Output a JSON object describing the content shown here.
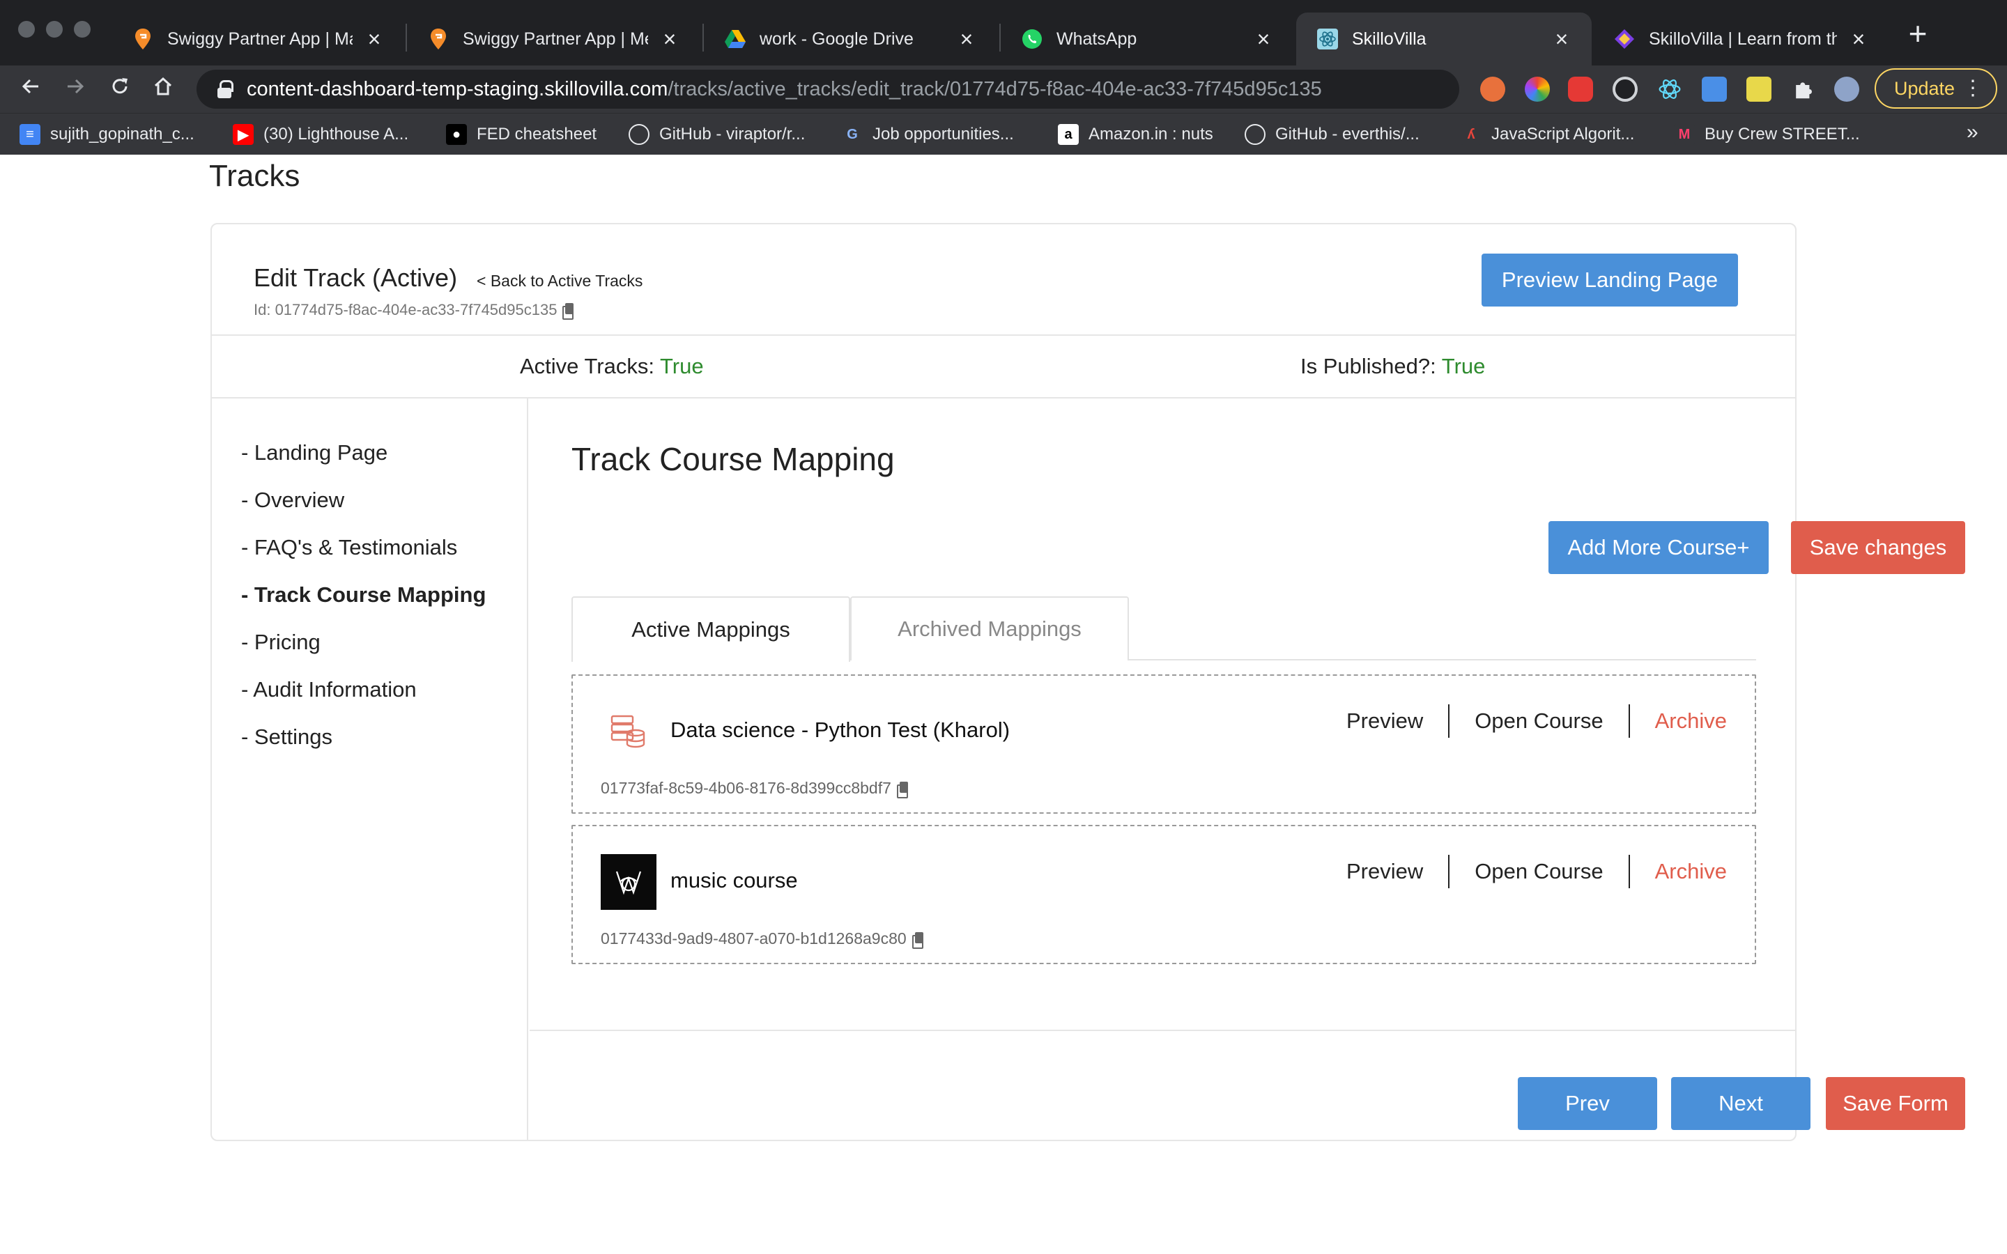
{
  "browser": {
    "tabs": [
      {
        "title": "Swiggy Partner App | Man",
        "icon": "swiggy-icon"
      },
      {
        "title": "Swiggy Partner App | Men",
        "icon": "swiggy-icon"
      },
      {
        "title": "work - Google Drive",
        "icon": "google-drive-icon"
      },
      {
        "title": "WhatsApp",
        "icon": "whatsapp-icon"
      },
      {
        "title": "SkilloVilla",
        "icon": "react-icon",
        "active": true
      },
      {
        "title": "SkilloVilla | Learn from the",
        "icon": "skillovilla-icon"
      }
    ],
    "close_glyph": "×",
    "new_tab_glyph": "+",
    "url": {
      "host": "content-dashboard-temp-staging.skillovilla.com",
      "path": "/tracks/active_tracks/edit_track/01774d75-f8ac-404e-ac33-7f745d95c135"
    },
    "update_label": "Update",
    "bookmarks": [
      {
        "label": "sujith_gopinath_c...",
        "icon": "google-docs-icon"
      },
      {
        "label": "(30) Lighthouse A...",
        "icon": "youtube-icon"
      },
      {
        "label": "FED cheatsheet",
        "icon": "medium-icon"
      },
      {
        "label": "GitHub - viraptor/r...",
        "icon": "github-icon"
      },
      {
        "label": "Job opportunities...",
        "icon": "job-icon"
      },
      {
        "label": "Amazon.in : nuts",
        "icon": "amazon-icon"
      },
      {
        "label": "GitHub - everthis/...",
        "icon": "github-icon"
      },
      {
        "label": "JavaScript Algorit...",
        "icon": "js-algo-icon"
      },
      {
        "label": "Buy Crew STREET...",
        "icon": "myntra-icon"
      }
    ],
    "bookmarks_more": "»"
  },
  "page": {
    "title": "Tracks",
    "edit_title": "Edit Track (Active)",
    "back_link": "< Back to Active Tracks",
    "track_id": "Id: 01774d75-f8ac-404e-ac33-7f745d95c135",
    "preview_landing_label": "Preview Landing Page",
    "status": {
      "active_label": "Active Tracks: ",
      "active_value": "True",
      "published_label": "Is Published?: ",
      "published_value": "True"
    },
    "sidebar": [
      {
        "label": "- Landing Page"
      },
      {
        "label": "- Overview"
      },
      {
        "label": "- FAQ's & Testimonials"
      },
      {
        "label": "- Track Course Mapping",
        "active": true
      },
      {
        "label": "- Pricing"
      },
      {
        "label": "- Audit Information"
      },
      {
        "label": "- Settings"
      }
    ],
    "section_title": "Track Course Mapping",
    "add_course_label": "Add More Course+",
    "save_changes_label": "Save changes",
    "mapping_tabs": [
      {
        "label": "Active Mappings",
        "active": true
      },
      {
        "label": "Archived Mappings",
        "active": false
      }
    ],
    "mappings": [
      {
        "name": "Data science - Python Test (Kharol)",
        "id": "01773faf-8c59-4b06-8176-8d399cc8bdf7",
        "thumb": "database-icon"
      },
      {
        "name": "music course",
        "id": "0177433d-9ad9-4807-a070-b1d1268a9c80",
        "thumb": "music-logo-icon"
      }
    ],
    "mapping_actions": {
      "preview": "Preview",
      "open": "Open Course",
      "archive": "Archive"
    },
    "footer": {
      "prev": "Prev",
      "next": "Next",
      "save_form": "Save Form"
    }
  },
  "colors": {
    "primary_blue": "#4a90d9",
    "danger_red": "#e05d4c",
    "success_green": "#2e8b2e",
    "update_yellow": "#fdd663"
  }
}
